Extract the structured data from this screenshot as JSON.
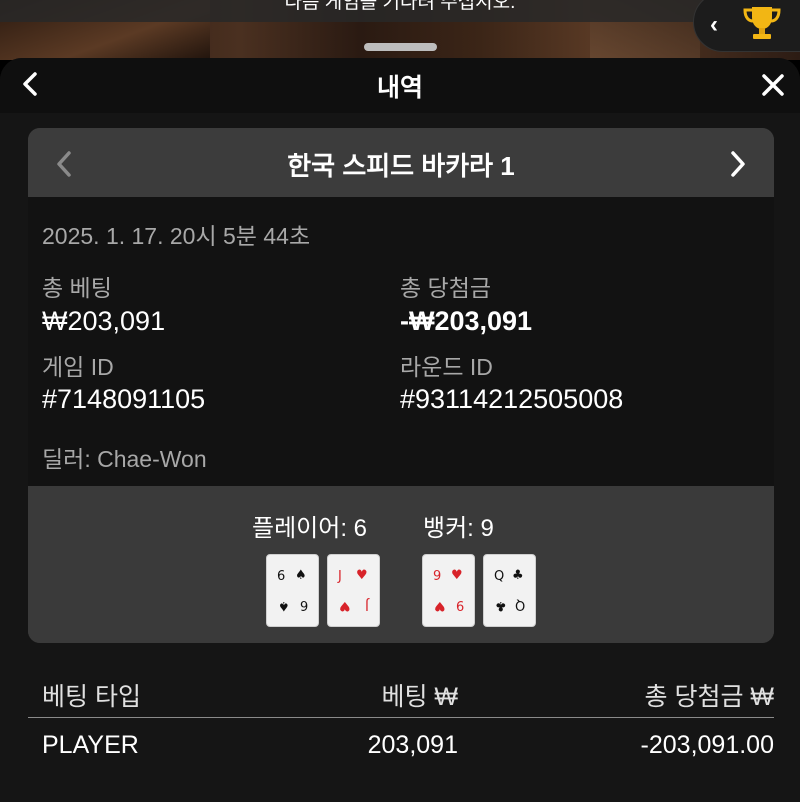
{
  "background": {
    "notice_text": "다음 게임을 기다려 주십시오."
  },
  "header": {
    "title": "내역"
  },
  "game_card": {
    "title": "한국 스피드 바카라 1",
    "timestamp": "2025. 1. 17. 20시 5분 44초",
    "total_bet_label": "총 베팅",
    "total_bet_value": "₩203,091",
    "total_win_label": "총 당첨금",
    "total_win_value": "-₩203,091",
    "game_id_label": "게임 ID",
    "game_id_value": "#7148091105",
    "round_id_label": "라운드 ID",
    "round_id_value": "#93114212505008",
    "dealer": "딜러: Chae-Won"
  },
  "result": {
    "player_label": "플레이어: 6",
    "banker_label": "뱅커: 9",
    "player_cards": [
      {
        "rank": "6",
        "suit": "♠",
        "color": "#111111"
      },
      {
        "rank": "J",
        "suit": "♥",
        "color": "#d8232a"
      }
    ],
    "banker_cards": [
      {
        "rank": "9",
        "suit": "♥",
        "color": "#d8232a"
      },
      {
        "rank": "Q",
        "suit": "♣",
        "color": "#111111"
      }
    ]
  },
  "bets_table": {
    "columns": [
      "베팅 타입",
      "베팅 ₩",
      "총 당첨금 ₩"
    ],
    "rows": [
      {
        "type": "PLAYER",
        "bet": "203,091",
        "win": "-203,091.00"
      }
    ]
  }
}
